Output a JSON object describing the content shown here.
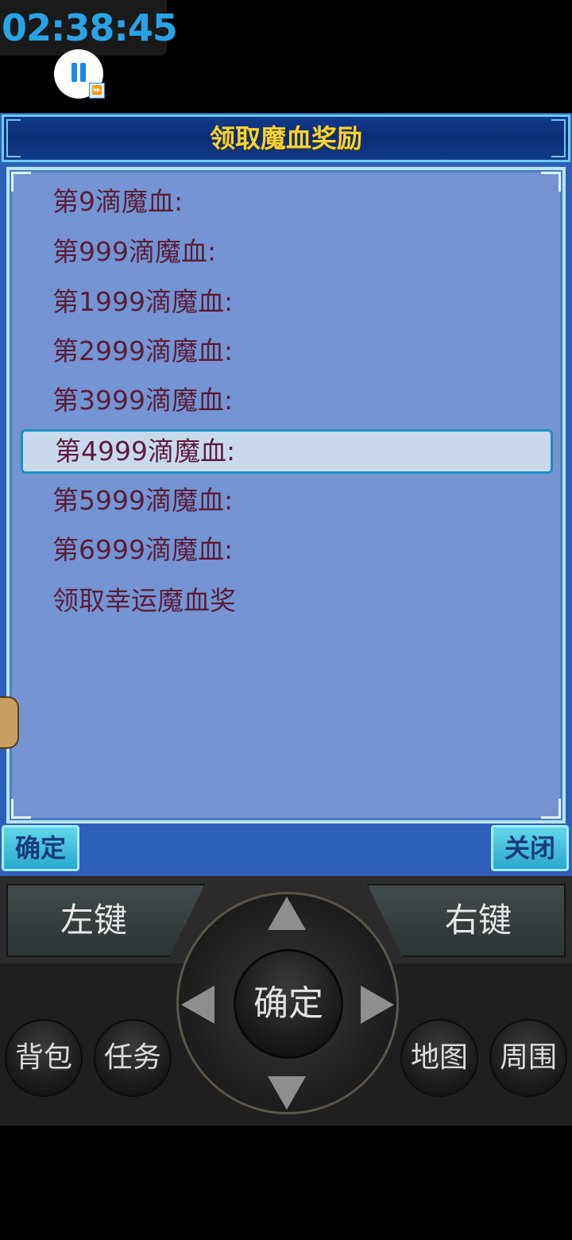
{
  "overlay": {
    "timer": "02:38:45",
    "fast_forward_glyph": "⏩"
  },
  "dialog": {
    "title": "领取魔血奖励",
    "items": [
      "第9滴魔血:",
      "第999滴魔血:",
      "第1999滴魔血:",
      "第2999滴魔血:",
      "第3999滴魔血:",
      "第4999滴魔血:",
      "第5999滴魔血:",
      "第6999滴魔血:",
      "领取幸运魔血奖"
    ],
    "selected_index": 5,
    "confirm_label": "确定",
    "close_label": "关闭"
  },
  "controller": {
    "left_soft_key": "左键",
    "right_soft_key": "右键",
    "ok_label": "确定",
    "bag_label": "背包",
    "task_label": "任务",
    "map_label": "地图",
    "nearby_label": "周围"
  },
  "colors": {
    "timer": "#29a3e6",
    "title": "#f4d23a",
    "item_text": "#5a1d3a",
    "panel_bg": "#7494d2",
    "dialog_bg": "#2d5fb8",
    "selected_border": "#1f8fc4"
  }
}
